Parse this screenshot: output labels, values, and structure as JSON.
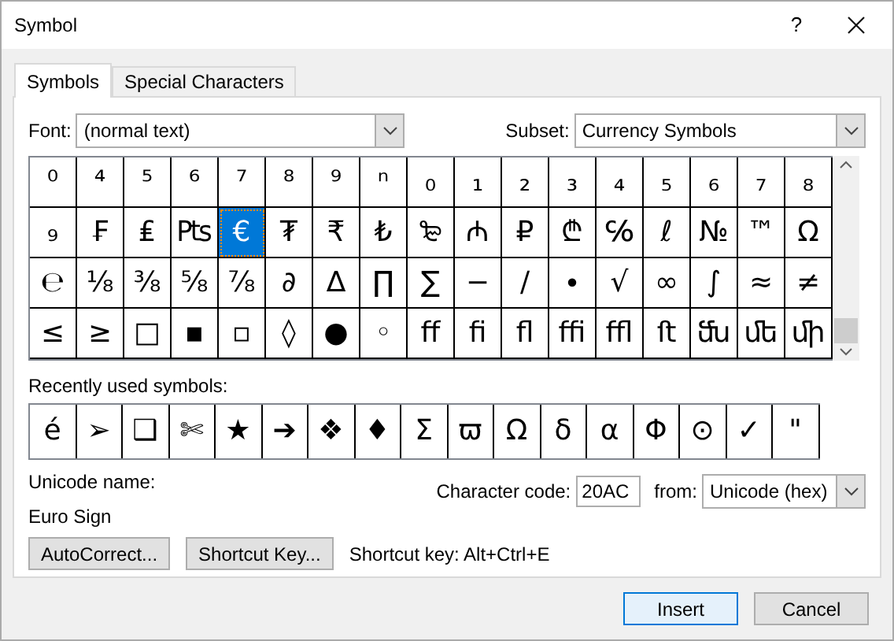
{
  "window": {
    "title": "Symbol",
    "help": "?"
  },
  "tabs": [
    {
      "label": "Symbols",
      "selected": true
    },
    {
      "label": "Special Characters",
      "selected": false
    }
  ],
  "font": {
    "label": "Font:",
    "value": "(normal text)"
  },
  "subset": {
    "label": "Subset:",
    "value": "Currency Symbols"
  },
  "grid": [
    [
      {
        "char": "⁰",
        "selected": false
      },
      {
        "char": "⁴",
        "selected": false
      },
      {
        "char": "⁵",
        "selected": false
      },
      {
        "char": "⁶",
        "selected": false
      },
      {
        "char": "⁷",
        "selected": false
      },
      {
        "char": "⁸",
        "selected": false
      },
      {
        "char": "⁹",
        "selected": false
      },
      {
        "char": "ⁿ",
        "selected": false
      },
      {
        "char": "₀",
        "selected": false
      },
      {
        "char": "₁",
        "selected": false
      },
      {
        "char": "₂",
        "selected": false
      },
      {
        "char": "₃",
        "selected": false
      },
      {
        "char": "₄",
        "selected": false
      },
      {
        "char": "₅",
        "selected": false
      },
      {
        "char": "₆",
        "selected": false
      },
      {
        "char": "₇",
        "selected": false
      },
      {
        "char": "₈",
        "selected": false
      }
    ],
    [
      {
        "char": "₉",
        "selected": false
      },
      {
        "char": "₣",
        "selected": false
      },
      {
        "char": "₤",
        "selected": false
      },
      {
        "char": "₧",
        "selected": false
      },
      {
        "char": "€",
        "selected": true
      },
      {
        "char": "₮",
        "selected": false
      },
      {
        "char": "₹",
        "selected": false
      },
      {
        "char": "₺",
        "selected": false
      },
      {
        "char": "₻",
        "selected": false
      },
      {
        "char": "₼",
        "selected": false
      },
      {
        "char": "₽",
        "selected": false
      },
      {
        "char": "₾",
        "selected": false
      },
      {
        "char": "℅",
        "selected": false
      },
      {
        "char": "ℓ",
        "selected": false
      },
      {
        "char": "№",
        "selected": false
      },
      {
        "char": "™",
        "selected": false
      },
      {
        "char": "Ω",
        "selected": false
      }
    ],
    [
      {
        "char": "℮",
        "selected": false
      },
      {
        "char": "⅛",
        "selected": false
      },
      {
        "char": "⅜",
        "selected": false
      },
      {
        "char": "⅝",
        "selected": false
      },
      {
        "char": "⅞",
        "selected": false
      },
      {
        "char": "∂",
        "selected": false
      },
      {
        "char": "∆",
        "selected": false
      },
      {
        "char": "∏",
        "selected": false
      },
      {
        "char": "∑",
        "selected": false
      },
      {
        "char": "−",
        "selected": false
      },
      {
        "char": "∕",
        "selected": false
      },
      {
        "char": "∙",
        "selected": false
      },
      {
        "char": "√",
        "selected": false
      },
      {
        "char": "∞",
        "selected": false
      },
      {
        "char": "∫",
        "selected": false
      },
      {
        "char": "≈",
        "selected": false
      },
      {
        "char": "≠",
        "selected": false
      }
    ],
    [
      {
        "char": "≤",
        "selected": false
      },
      {
        "char": "≥",
        "selected": false
      },
      {
        "char": "□",
        "selected": false
      },
      {
        "char": "▪",
        "selected": false
      },
      {
        "char": "▫",
        "selected": false
      },
      {
        "char": "◊",
        "selected": false
      },
      {
        "char": "●",
        "selected": false
      },
      {
        "char": "◦",
        "selected": false
      },
      {
        "char": "ﬀ",
        "selected": false
      },
      {
        "char": "ﬁ",
        "selected": false
      },
      {
        "char": "ﬂ",
        "selected": false
      },
      {
        "char": "ﬃ",
        "selected": false
      },
      {
        "char": "ﬄ",
        "selected": false
      },
      {
        "char": "ﬅ",
        "selected": false
      },
      {
        "char": "ﬓ",
        "selected": false
      },
      {
        "char": "ﬔ",
        "selected": false
      },
      {
        "char": "ﬕ",
        "selected": false
      }
    ]
  ],
  "recent": {
    "label": "Recently used symbols:",
    "symbols": [
      "é",
      "➢",
      "❑",
      "✄",
      "★",
      "➔",
      "❖",
      "♦",
      "Σ",
      "ϖ",
      "Ω",
      "δ",
      "α",
      "Φ",
      "⊙",
      "✓",
      "\""
    ]
  },
  "unicode_name": {
    "label": "Unicode name:",
    "value": "Euro Sign"
  },
  "character_code": {
    "label": "Character code:",
    "value": "20AC"
  },
  "from": {
    "label": "from:",
    "value": "Unicode (hex)"
  },
  "buttons": [
    "AutoCorrect...",
    "Shortcut Key..."
  ],
  "shortcut_text": "Shortcut key: Alt+Ctrl+E",
  "footer_buttons": [
    {
      "label": "Insert",
      "default": true
    },
    {
      "label": "Cancel",
      "default": false
    }
  ]
}
